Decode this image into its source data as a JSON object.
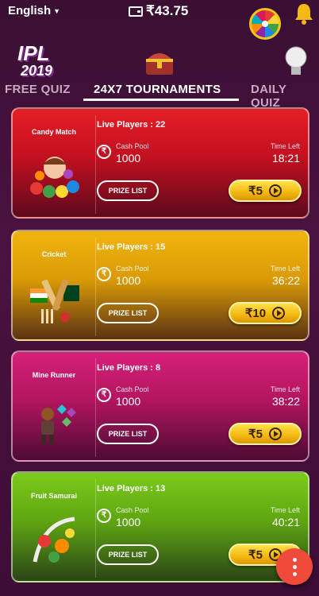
{
  "header": {
    "language": "English",
    "wallet_balance": "₹43.75"
  },
  "nav": {
    "logo_title": "IPL",
    "logo_year": "2019",
    "tabs": [
      {
        "label": "FREE QUIZ",
        "active": false
      },
      {
        "label": "24X7 TOURNAMENTS",
        "active": true
      },
      {
        "label": "DAILY QUIZ",
        "active": false
      }
    ]
  },
  "cards": [
    {
      "game": "Candy Match",
      "live_players": "Live Players : 22",
      "cash_pool_label": "Cash Pool",
      "cash_pool": "1000",
      "time_left_label": "Time Left",
      "time_left": "18:21",
      "prize_label": "PRIZE LIST",
      "fee": "₹5",
      "color": "#d8192a"
    },
    {
      "game": "Cricket",
      "live_players": "Live Players : 15",
      "cash_pool_label": "Cash Pool",
      "cash_pool": "1000",
      "time_left_label": "Time Left",
      "time_left": "36:22",
      "prize_label": "PRIZE LIST",
      "fee": "₹10",
      "color": "#eab00c"
    },
    {
      "game": "Mine Runner",
      "live_players": "Live Players : 8",
      "cash_pool_label": "Cash Pool",
      "cash_pool": "1000",
      "time_left_label": "Time Left",
      "time_left": "38:22",
      "prize_label": "PRIZE LIST",
      "fee": "₹5",
      "color": "#c81a6d"
    },
    {
      "game": "Fruit Samurai",
      "live_players": "Live Players : 13",
      "cash_pool_label": "Cash Pool",
      "cash_pool": "1000",
      "time_left_label": "Time Left",
      "time_left": "40:21",
      "prize_label": "PRIZE LIST",
      "fee": "₹5",
      "color": "#6fb816"
    }
  ],
  "icons": {
    "wallet": "wallet-icon",
    "spin_wheel": "spin-wheel-icon",
    "notifications": "bell-icon",
    "treasure": "treasure-chest-icon",
    "hint": "lightbulb-icon",
    "more": "more-vertical-icon"
  },
  "colors": {
    "background": "#3d0d36",
    "fee_button": "#f3b70e",
    "fab": "#f04a3a"
  }
}
